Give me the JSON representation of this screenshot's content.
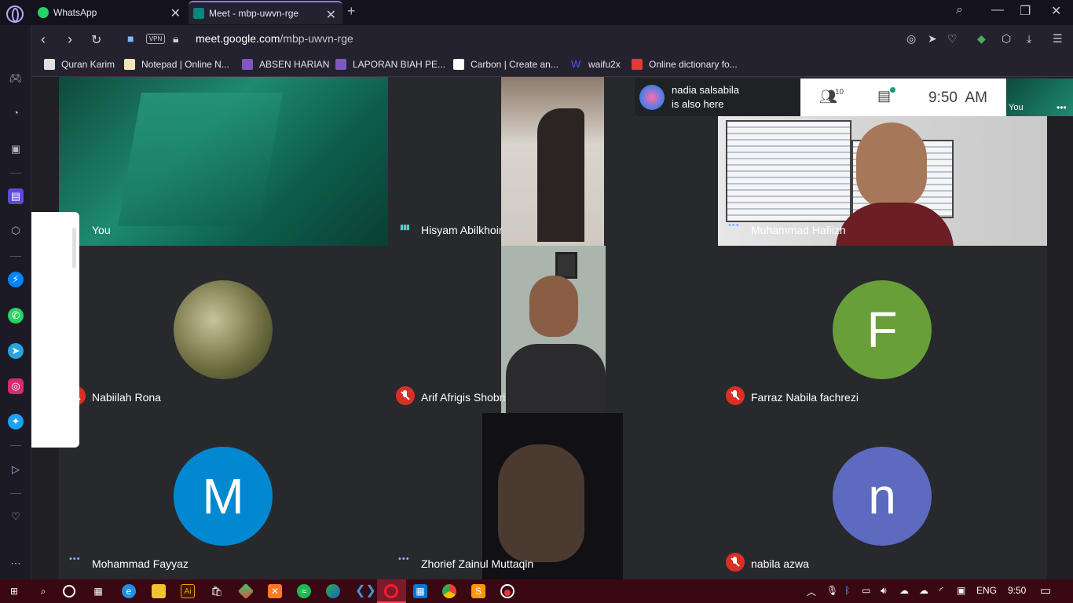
{
  "browser": {
    "tabs": [
      {
        "label": "WhatsApp",
        "favicon_color": "#25d366"
      },
      {
        "label": "Meet - mbp-uwvn-rge",
        "favicon_color": "#00897b"
      }
    ],
    "url_domain": "meet.google.com",
    "url_path": "/mbp-uwvn-rge",
    "vpn_label": "VPN",
    "bookmarks": [
      {
        "label": "Quran Karim",
        "icon_color": "#e0e0e0"
      },
      {
        "label": "Notepad | Online N...",
        "icon_color": "#f3e6b5"
      },
      {
        "label": "ABSEN HARIAN",
        "icon_color": "#7e57c2"
      },
      {
        "label": "LAPORAN BIAH PE...",
        "icon_color": "#7e57c2"
      },
      {
        "label": "Carbon | Create an...",
        "icon_color": "#ffffff"
      },
      {
        "label": "waifu2x",
        "icon_color": "#3d5afe"
      },
      {
        "label": "Online dictionary fo...",
        "icon_color": "#e53935"
      }
    ]
  },
  "meet": {
    "notification": {
      "name": "nadia salsabila",
      "message": "is also here"
    },
    "participants_count": "10",
    "clock": "9:50  AM",
    "self_label": "You",
    "tiles": [
      {
        "name": "You",
        "status": "dots"
      },
      {
        "name": "Hisyam Abilkhoir",
        "status": "speak"
      },
      {
        "name": "Muhammad Hafiizh",
        "status": "dots"
      },
      {
        "name": "Nabiilah Rona",
        "status": "muted"
      },
      {
        "name": "Arif Afrigis Shobri",
        "status": "muted"
      },
      {
        "name": "Farraz Nabila fachrezi",
        "status": "muted",
        "initial": "F",
        "avatar_color": "#689f38"
      },
      {
        "name": "Mohammad Fayyaz",
        "status": "dots",
        "initial": "M",
        "avatar_color": "#0288d1"
      },
      {
        "name": "Zhorief Zainul Muttaqin",
        "status": "dots"
      },
      {
        "name": "nabila azwa",
        "status": "muted",
        "initial": "n",
        "avatar_color": "#5c6bc0"
      }
    ]
  },
  "taskbar": {
    "language": "ENG",
    "time": "9:50"
  }
}
